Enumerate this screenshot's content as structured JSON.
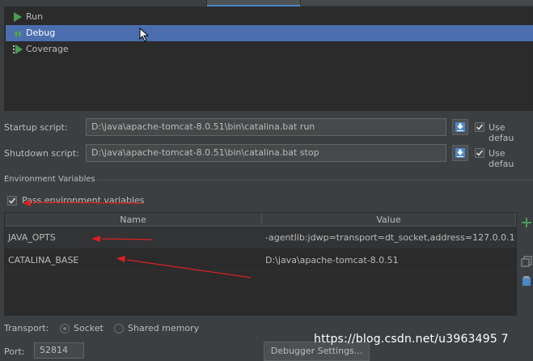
{
  "executors": [
    {
      "label": "Run",
      "icon": "run-icon"
    },
    {
      "label": "Debug",
      "icon": "debug-icon",
      "selected": true
    },
    {
      "label": "Coverage",
      "icon": "coverage-icon"
    }
  ],
  "startup": {
    "label": "Startup script:",
    "value": "D:\\java\\apache-tomcat-8.0.51\\bin\\catalina.bat run",
    "use_default_label": "Use defau",
    "use_default_checked": true
  },
  "shutdown": {
    "label": "Shutdown script:",
    "value": "D:\\java\\apache-tomcat-8.0.51\\bin\\catalina.bat stop",
    "use_default_label": "Use defau",
    "use_default_checked": true
  },
  "env": {
    "section_title": "Environment Variables",
    "pass_label": "Pass environment variables",
    "pass_checked": true,
    "columns": [
      "Name",
      "Value"
    ],
    "rows": [
      {
        "name": "JAVA_OPTS",
        "value": "-agentlib:jdwp=transport=dt_socket,address=127.0.0.1:..."
      },
      {
        "name": "CATALINA_BASE",
        "value": "D:\\java\\apache-tomcat-8.0.51"
      }
    ]
  },
  "transport": {
    "label": "Transport:",
    "socket_label": "Socket",
    "shared_memory_label": "Shared memory",
    "selected": "Socket"
  },
  "port": {
    "label": "Port:",
    "value": "52814"
  },
  "debugger_settings_label": "Debugger Settings...",
  "watermark": "https://blog.csdn.net/u3963495 7",
  "colors": {
    "background": "#3c3f41",
    "list_bg": "#2b2b2b",
    "selection": "#4b6eaf",
    "text": "#bbbbbb",
    "run_green": "#499c54",
    "annotation_red": "#e02020"
  }
}
